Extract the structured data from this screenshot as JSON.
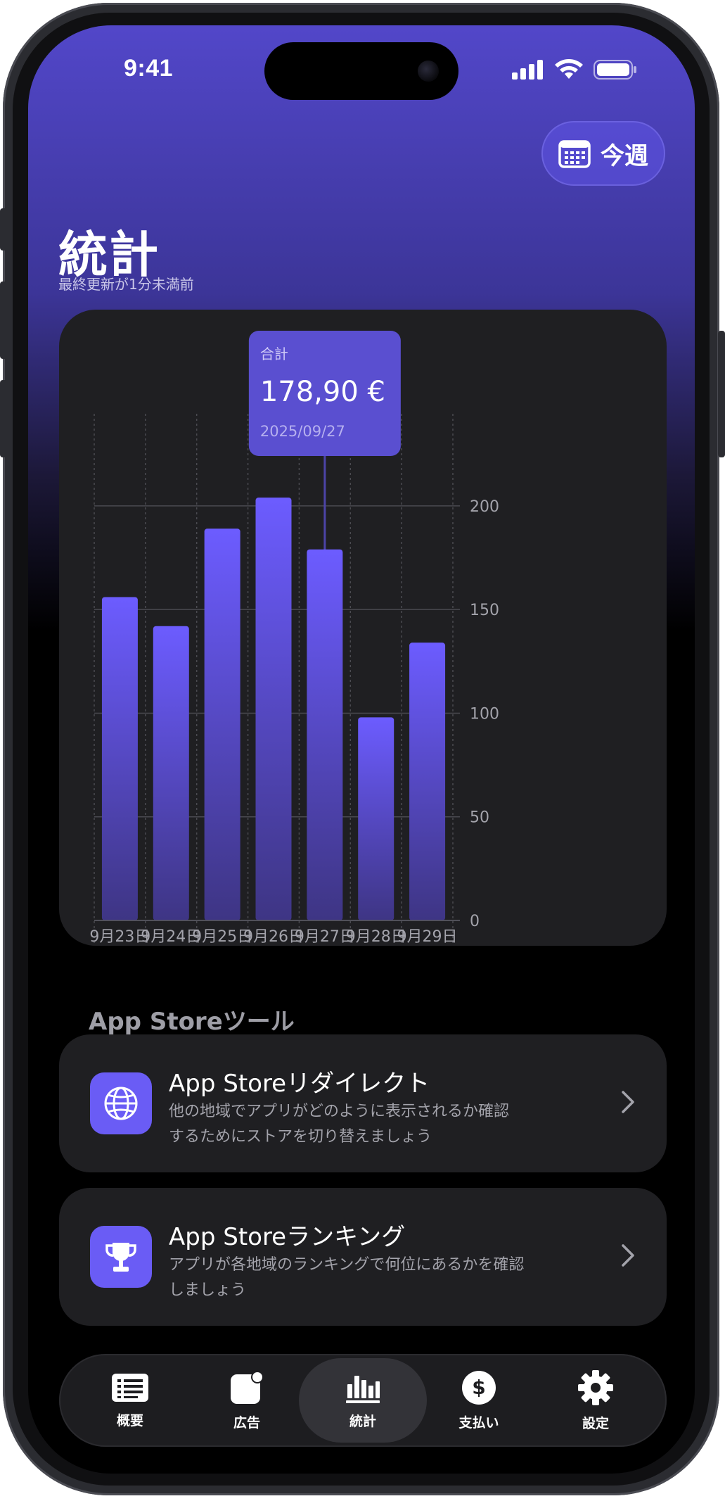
{
  "status_bar": {
    "time": "9:41"
  },
  "header": {
    "week_button_label": "今週",
    "title": "統計",
    "subtitle": "最終更新が1分未満前"
  },
  "tooltip": {
    "label": "合計",
    "value": "178,90 €",
    "date": "2025/09/27"
  },
  "chart_data": {
    "type": "bar",
    "categories": [
      "9月23日",
      "9月24日",
      "9月25日",
      "9月26日",
      "9月27日",
      "9月28日",
      "9月29日"
    ],
    "values": [
      156,
      142,
      189,
      204,
      179,
      98,
      134
    ],
    "ylim": [
      0,
      220
    ],
    "yticks": [
      0,
      50,
      100,
      150,
      200
    ],
    "selected_index": 4,
    "grid": true,
    "bar_color_top": "#6c5cff",
    "bar_color_bottom": "#3e3584"
  },
  "tools_section": {
    "title": "App Storeツール",
    "items": [
      {
        "title": "App Storeリダイレクト",
        "desc_line1": "他の地域でアプリがどのように表示されるか確認",
        "desc_line2": "するためにストアを切り替えましょう",
        "icon": "globe-icon"
      },
      {
        "title": "App Storeランキング",
        "desc_line1": "アプリが各地域のランキングで何位にあるかを確認",
        "desc_line2": "しましょう",
        "icon": "trophy-icon"
      }
    ]
  },
  "tab_bar": {
    "items": [
      {
        "label": "概要",
        "icon": "list-icon"
      },
      {
        "label": "広告",
        "icon": "ads-icon"
      },
      {
        "label": "統計",
        "icon": "bar-chart-icon",
        "active": true
      },
      {
        "label": "支払い",
        "icon": "dollar-icon"
      },
      {
        "label": "設定",
        "icon": "gear-icon"
      }
    ]
  },
  "colors": {
    "accent": "#6a5cf5",
    "card_background": "#1f1f22",
    "header_gradient_top": "#5247c9"
  }
}
